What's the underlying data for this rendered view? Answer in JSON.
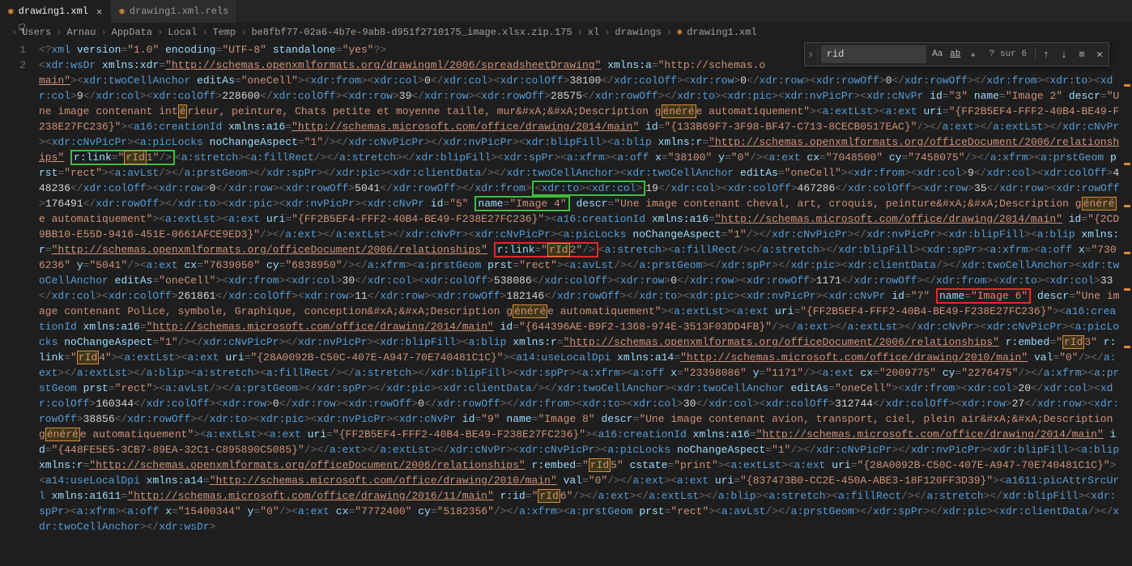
{
  "tabs": [
    {
      "label": "drawing1.xml",
      "active": true,
      "closable": true
    },
    {
      "label": "drawing1.xml.rels",
      "active": false,
      "closable": false
    }
  ],
  "breadcrumb": [
    "Users",
    "Arnau",
    "AppData",
    "Local",
    "Temp",
    "be8fbf77-02a6-4b7e-9ab8-d951f2710175_image.xlsx.zip.175",
    "xl",
    "drawings",
    "drawing1.xml"
  ],
  "line_numbers": [
    "1",
    "2"
  ],
  "find": {
    "value": "rid",
    "count": "? sur 6",
    "opts": [
      "Aa",
      "ab",
      "⁎"
    ]
  },
  "scroll_markers": [
    8,
    23,
    31,
    40,
    47,
    58
  ],
  "chart_data": null
}
